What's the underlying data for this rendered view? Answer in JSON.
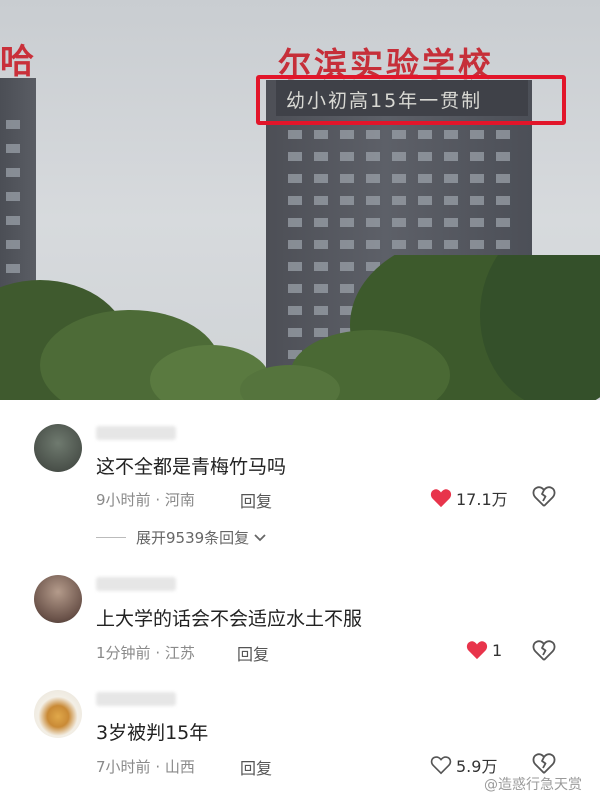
{
  "photo": {
    "sign_left": "哈",
    "sign_right": "尔滨实验学校",
    "slogan": "幼小初高15年一贯制"
  },
  "comments": [
    {
      "text": "这不全都是青梅竹马吗",
      "time": "9小时前",
      "location": "河南",
      "reply_label": "回复",
      "likes": "17.1万",
      "liked": true,
      "expand_label": "展开9539条回复"
    },
    {
      "text": "上大学的话会不会适应水土不服",
      "time": "1分钟前",
      "location": "江苏",
      "reply_label": "回复",
      "likes": "1",
      "liked": true
    },
    {
      "text": "3岁被判15年",
      "time": "7小时前",
      "location": "山西",
      "reply_label": "回复",
      "likes": "5.9万",
      "liked": false
    }
  ],
  "watermark": "@造惑行急天赏",
  "colors": {
    "like_red": "#e8344b",
    "highlight_red": "#e2152a"
  }
}
